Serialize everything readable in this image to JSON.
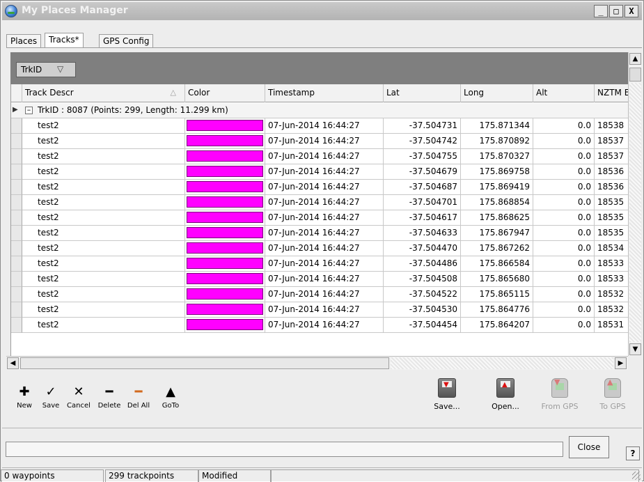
{
  "window": {
    "title": "My Places Manager",
    "controls": {
      "minimize": "_",
      "maximize": "□",
      "close": "X"
    }
  },
  "tabs": [
    {
      "label": "Places",
      "active": false
    },
    {
      "label": "Tracks*",
      "active": true
    },
    {
      "label": "GPS Config",
      "active": false
    }
  ],
  "group_panel": {
    "chip_label": "TrkID",
    "chip_icon": "filter-triangle-icon"
  },
  "grid": {
    "columns": [
      "Track Descr",
      "Color",
      "Timestamp",
      "Lat",
      "Long",
      "Alt",
      "NZTM E"
    ],
    "group_row": "TrkID : 8087 (Points: 299, Length: 11.299 km)",
    "swatch_color": "#ff00ff",
    "rows": [
      {
        "descr": "test2",
        "timestamp": "07-Jun-2014 16:44:27",
        "lat": "-37.504731",
        "long": "175.871344",
        "alt": "0.0",
        "nztm": "18538"
      },
      {
        "descr": "test2",
        "timestamp": "07-Jun-2014 16:44:27",
        "lat": "-37.504742",
        "long": "175.870892",
        "alt": "0.0",
        "nztm": "18537"
      },
      {
        "descr": "test2",
        "timestamp": "07-Jun-2014 16:44:27",
        "lat": "-37.504755",
        "long": "175.870327",
        "alt": "0.0",
        "nztm": "18537"
      },
      {
        "descr": "test2",
        "timestamp": "07-Jun-2014 16:44:27",
        "lat": "-37.504679",
        "long": "175.869758",
        "alt": "0.0",
        "nztm": "18536"
      },
      {
        "descr": "test2",
        "timestamp": "07-Jun-2014 16:44:27",
        "lat": "-37.504687",
        "long": "175.869419",
        "alt": "0.0",
        "nztm": "18536"
      },
      {
        "descr": "test2",
        "timestamp": "07-Jun-2014 16:44:27",
        "lat": "-37.504701",
        "long": "175.868854",
        "alt": "0.0",
        "nztm": "18535"
      },
      {
        "descr": "test2",
        "timestamp": "07-Jun-2014 16:44:27",
        "lat": "-37.504617",
        "long": "175.868625",
        "alt": "0.0",
        "nztm": "18535"
      },
      {
        "descr": "test2",
        "timestamp": "07-Jun-2014 16:44:27",
        "lat": "-37.504633",
        "long": "175.867947",
        "alt": "0.0",
        "nztm": "18535"
      },
      {
        "descr": "test2",
        "timestamp": "07-Jun-2014 16:44:27",
        "lat": "-37.504470",
        "long": "175.867262",
        "alt": "0.0",
        "nztm": "18534"
      },
      {
        "descr": "test2",
        "timestamp": "07-Jun-2014 16:44:27",
        "lat": "-37.504486",
        "long": "175.866584",
        "alt": "0.0",
        "nztm": "18533"
      },
      {
        "descr": "test2",
        "timestamp": "07-Jun-2014 16:44:27",
        "lat": "-37.504508",
        "long": "175.865680",
        "alt": "0.0",
        "nztm": "18533"
      },
      {
        "descr": "test2",
        "timestamp": "07-Jun-2014 16:44:27",
        "lat": "-37.504522",
        "long": "175.865115",
        "alt": "0.0",
        "nztm": "18532"
      },
      {
        "descr": "test2",
        "timestamp": "07-Jun-2014 16:44:27",
        "lat": "-37.504530",
        "long": "175.864776",
        "alt": "0.0",
        "nztm": "18532"
      },
      {
        "descr": "test2",
        "timestamp": "07-Jun-2014 16:44:27",
        "lat": "-37.504454",
        "long": "175.864207",
        "alt": "0.0",
        "nztm": "18531"
      }
    ]
  },
  "toolbar": {
    "new": "New",
    "save": "Save",
    "cancel": "Cancel",
    "delete": "Delete",
    "del_all": "Del All",
    "goto": "GoTo",
    "save_file": "Save...",
    "open_file": "Open...",
    "from_gps": "From GPS",
    "to_gps": "To GPS"
  },
  "footer": {
    "close": "Close",
    "help": "?"
  },
  "status": {
    "waypoints": "0 waypoints",
    "trackpoints": "299 trackpoints",
    "state": "Modified"
  }
}
